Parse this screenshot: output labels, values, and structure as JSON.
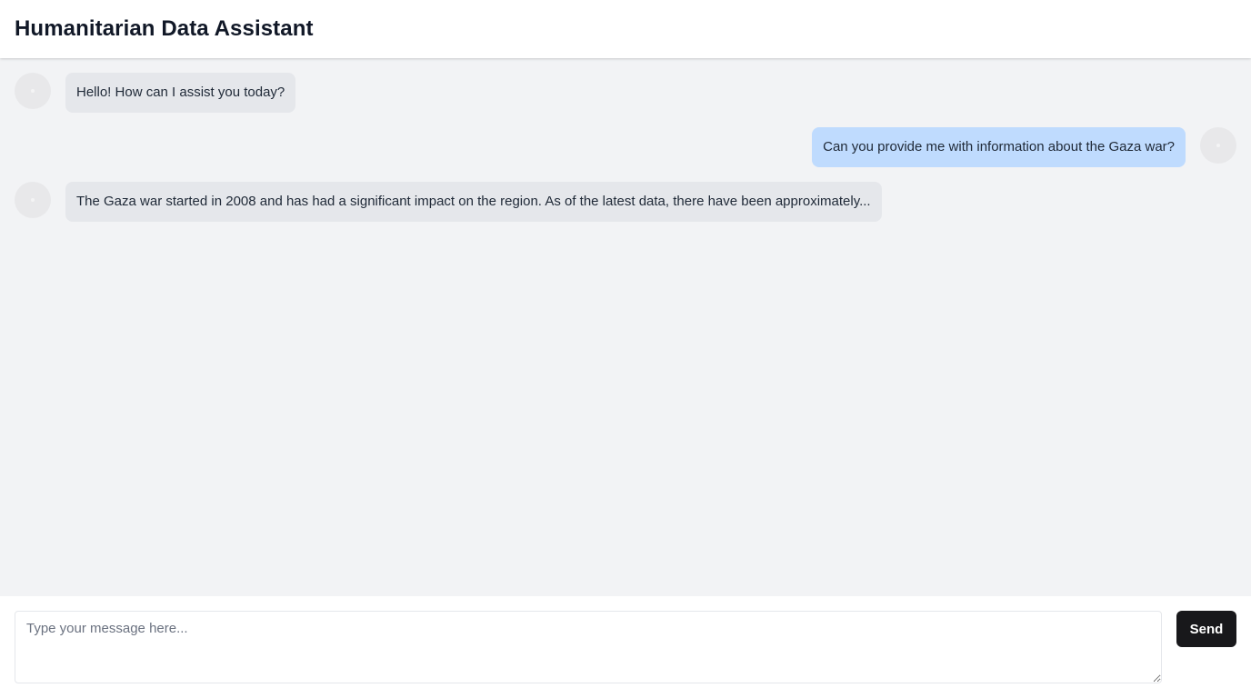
{
  "header": {
    "title": "Humanitarian Data Assistant"
  },
  "messages": [
    {
      "role": "assistant",
      "text": "Hello! How can I assist you today?",
      "avatar_icon": "assistant-avatar-icon"
    },
    {
      "role": "user",
      "text": "Can you provide me with information about the Gaza war?",
      "avatar_icon": "user-avatar-icon"
    },
    {
      "role": "assistant",
      "text": "The Gaza war started in 2008 and has had a significant impact on the region. As of the latest data, there have been approximately...",
      "avatar_icon": "assistant-avatar-icon"
    }
  ],
  "composer": {
    "placeholder": "Type your message here...",
    "value": "",
    "send_label": "Send"
  },
  "colors": {
    "assistant_bubble": "#e5e7eb",
    "user_bubble": "#bfdbfe",
    "send_button": "#18181b",
    "chat_background": "#f2f3f5"
  }
}
